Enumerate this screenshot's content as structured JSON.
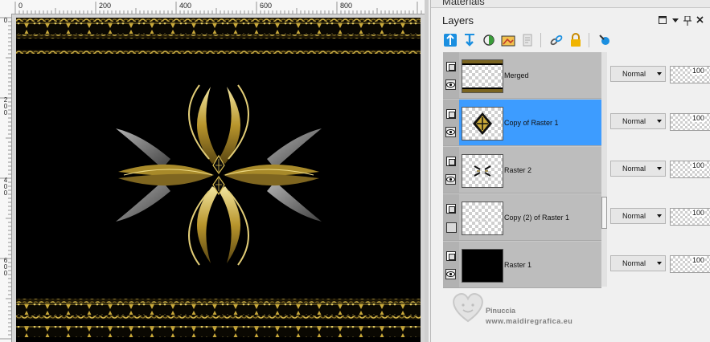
{
  "rulers": {
    "top_labels": [
      "0",
      "200",
      "400",
      "600",
      "800"
    ],
    "left_labels": [
      "0",
      "2\n0\n0",
      "4\n0\n0",
      "6\n0\n0"
    ]
  },
  "materials_panel": {
    "title": "Materials"
  },
  "layers_panel": {
    "title": "Layers",
    "header_icons": [
      "restore-icon",
      "dropdown-icon",
      "pin-icon",
      "close-icon"
    ],
    "toolbar_icons": [
      "new-raster-layer-icon",
      "new-vector-layer-icon",
      "new-adjustment-layer-icon",
      "new-mask-layer-icon",
      "layer-properties-icon",
      "link-icon",
      "lock-icon",
      "dropper-icon"
    ],
    "layers": [
      {
        "name": "Merged",
        "blend_mode": "Normal",
        "opacity": "100",
        "opacity_fraction": 1.0,
        "visible": true,
        "selected": false,
        "thumb": "border"
      },
      {
        "name": "Copy of Raster 1",
        "blend_mode": "Normal",
        "opacity": "100",
        "opacity_fraction": 1.0,
        "visible": true,
        "selected": true,
        "thumb": "diamond"
      },
      {
        "name": "Raster 2",
        "blend_mode": "Normal",
        "opacity": "100",
        "opacity_fraction": 1.0,
        "visible": true,
        "selected": false,
        "thumb": "petals"
      },
      {
        "name": "Copy (2) of Raster 1",
        "blend_mode": "Normal",
        "opacity": "100",
        "opacity_fraction": 1.0,
        "visible": false,
        "selected": false,
        "thumb": "faint"
      },
      {
        "name": "Raster 1",
        "blend_mode": "Normal",
        "opacity": "100",
        "opacity_fraction": 1.0,
        "visible": true,
        "selected": false,
        "thumb": "black"
      }
    ]
  },
  "watermark": {
    "line1": "Pinuccia",
    "line2": "www.maidiregrafica.eu"
  },
  "colors": {
    "selected_row": "#3d9cff",
    "gold": "#c9a93a",
    "canvas_bg": "#000000"
  }
}
